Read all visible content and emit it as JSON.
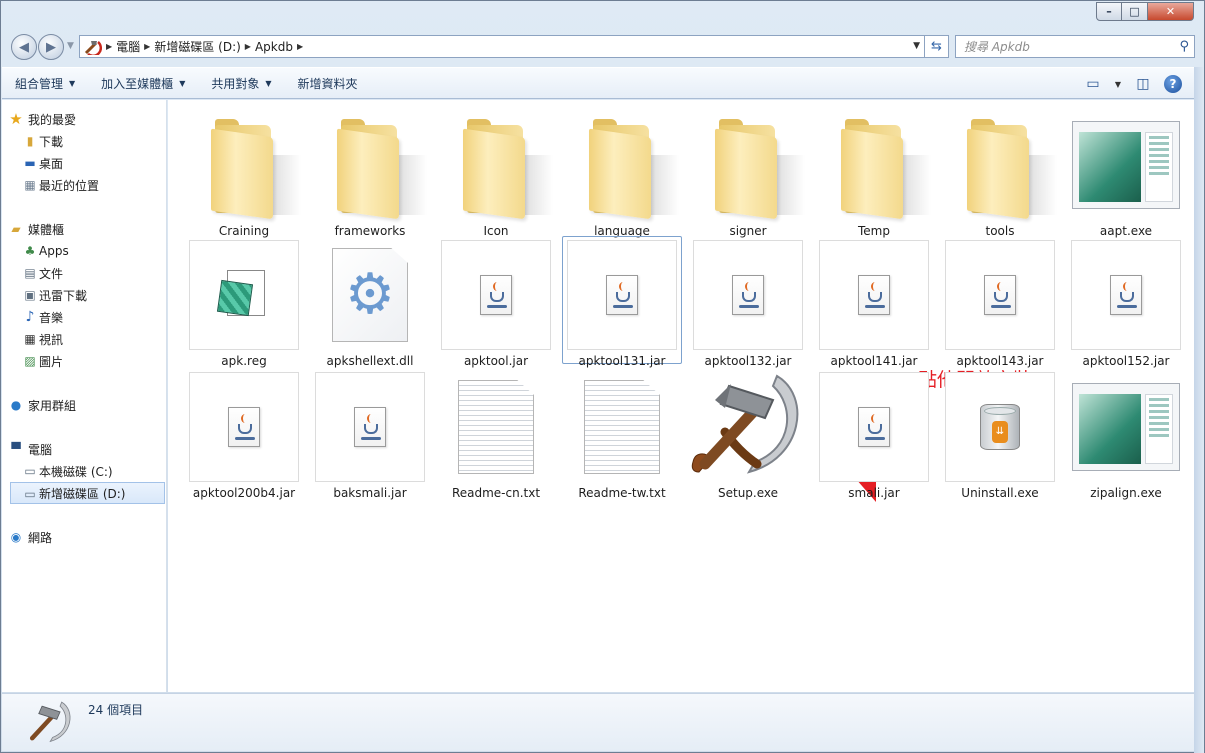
{
  "window": {
    "caption_min": "–",
    "caption_max": "□",
    "caption_close": "✕"
  },
  "address": {
    "crumbs": [
      "電腦",
      "新增磁碟區 (D:)",
      "Apkdb"
    ],
    "search_placeholder": "搜尋 Apkdb"
  },
  "toolbar": {
    "items": [
      "組合管理",
      "加入至媒體櫃",
      "共用對象",
      "新增資料夾"
    ]
  },
  "nav": {
    "favorites": {
      "label": "我的最愛",
      "items": [
        "下載",
        "桌面",
        "最近的位置"
      ]
    },
    "libraries": {
      "label": "媒體櫃",
      "items": [
        "Apps",
        "文件",
        "迅雷下載",
        "音樂",
        "視訊",
        "圖片"
      ]
    },
    "homegroup": {
      "label": "家用群組"
    },
    "computer": {
      "label": "電腦",
      "items": [
        "本機磁碟 (C:)",
        "新增磁碟區 (D:)"
      ]
    },
    "network": {
      "label": "網路"
    }
  },
  "files": [
    {
      "name": "Craining",
      "kind": "folder"
    },
    {
      "name": "frameworks",
      "kind": "folder"
    },
    {
      "name": "Icon",
      "kind": "folder"
    },
    {
      "name": "language",
      "kind": "folder"
    },
    {
      "name": "signer",
      "kind": "folder"
    },
    {
      "name": "Temp",
      "kind": "folder"
    },
    {
      "name": "tools",
      "kind": "folder"
    },
    {
      "name": "aapt.exe",
      "kind": "app"
    },
    {
      "name": "apk.reg",
      "kind": "reg"
    },
    {
      "name": "apkshellext.dll",
      "kind": "dll"
    },
    {
      "name": "apktool.jar",
      "kind": "jar"
    },
    {
      "name": "apktool131.jar",
      "kind": "jar"
    },
    {
      "name": "apktool132.jar",
      "kind": "jar"
    },
    {
      "name": "apktool141.jar",
      "kind": "jar"
    },
    {
      "name": "apktool143.jar",
      "kind": "jar"
    },
    {
      "name": "apktool152.jar",
      "kind": "jar"
    },
    {
      "name": "apktool200b4.jar",
      "kind": "jar"
    },
    {
      "name": "baksmali.jar",
      "kind": "jar"
    },
    {
      "name": "Readme-cn.txt",
      "kind": "txt"
    },
    {
      "name": "Readme-tw.txt",
      "kind": "txt"
    },
    {
      "name": "Setup.exe",
      "kind": "setup"
    },
    {
      "name": "smali.jar",
      "kind": "jar"
    },
    {
      "name": "Uninstall.exe",
      "kind": "uninstall"
    },
    {
      "name": "zipalign.exe",
      "kind": "app"
    }
  ],
  "selected_file": "apktool131.jar",
  "annotation": {
    "text": "點他開啟安裝",
    "color": "#e51e24"
  },
  "status": {
    "count": "24 個項目"
  }
}
